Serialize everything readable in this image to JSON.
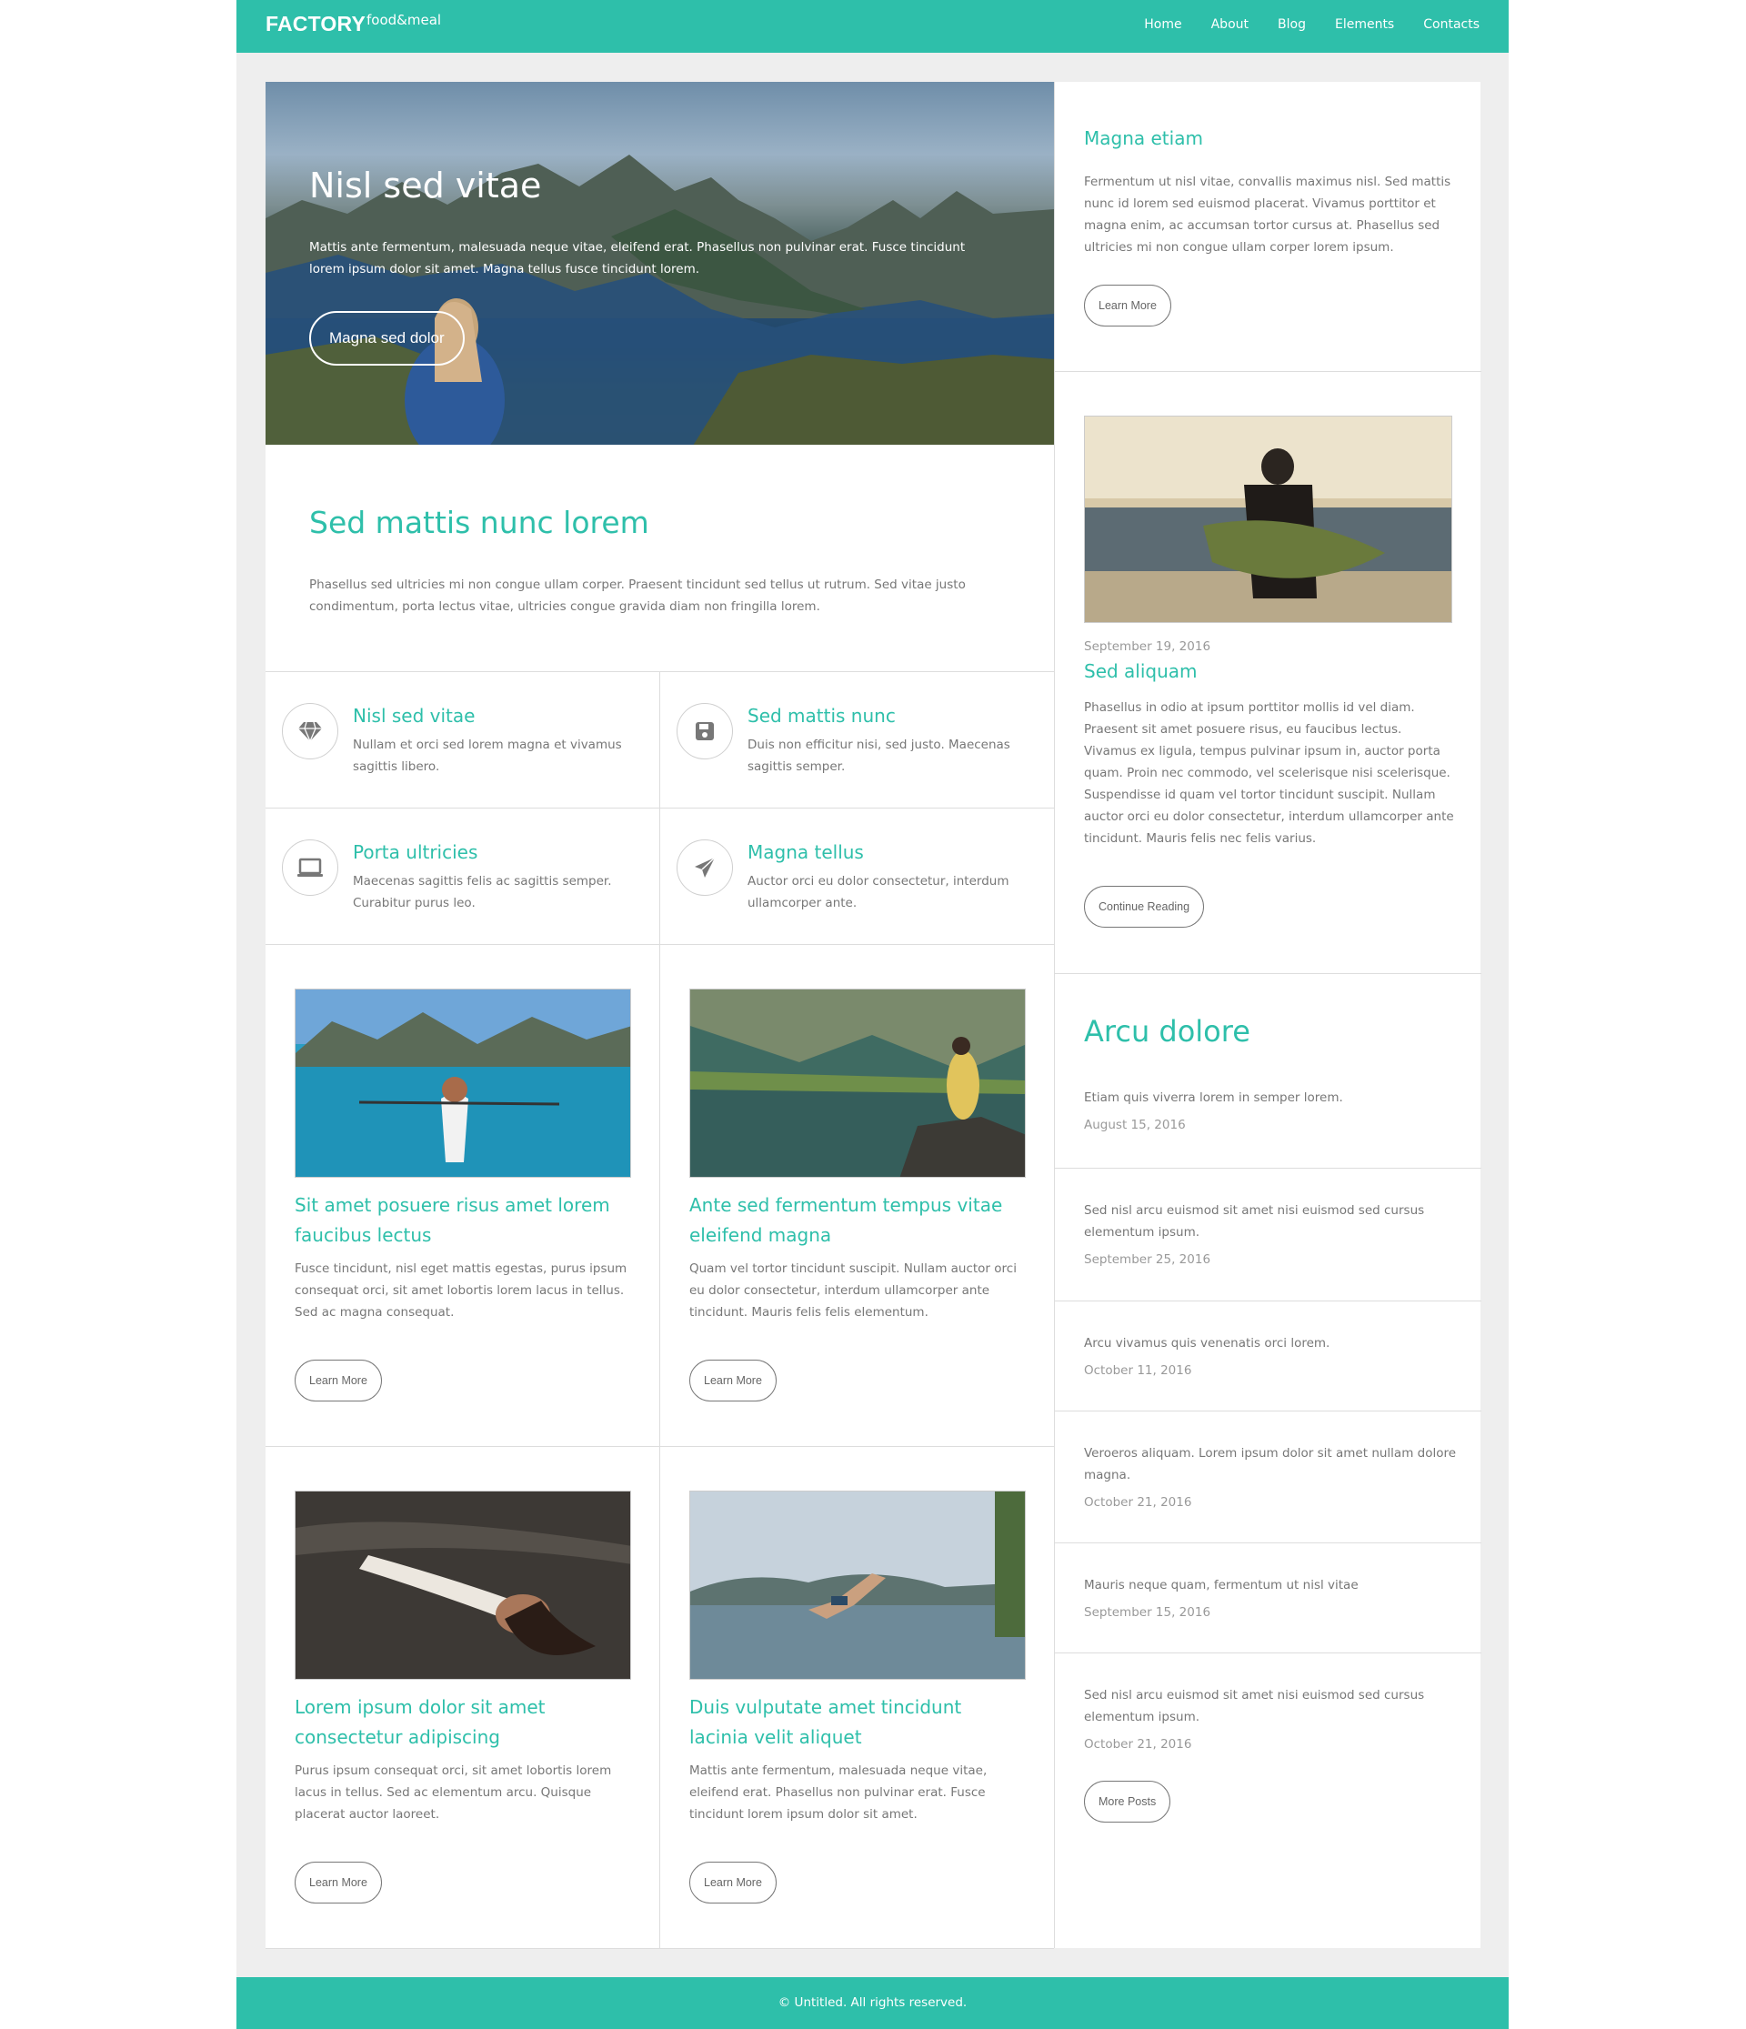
{
  "header": {
    "logo": "FACTORY",
    "logo_sub": "food&meal",
    "nav": [
      "Home",
      "About",
      "Blog",
      "Elements",
      "Contacts"
    ]
  },
  "hero": {
    "title": "Nisl sed vitae",
    "text": "Mattis ante fermentum, malesuada neque vitae, eleifend erat. Phasellus non pulvinar erat. Fusce tincidunt lorem ipsum dolor sit amet. Magna tellus fusce tincidunt lorem.",
    "button": "Magna sed dolor"
  },
  "intro": {
    "title": "Sed mattis nunc lorem",
    "text": "Phasellus sed ultricies mi non congue ullam corper. Praesent tincidunt sed tellus ut rutrum. Sed vitae justo condimentum, porta lectus vitae, ultricies congue gravida diam non fringilla lorem."
  },
  "features": [
    {
      "icon": "diamond-icon",
      "title": "Nisl sed vitae",
      "text": "Nullam et orci sed lorem magna et vivamus sagittis libero."
    },
    {
      "icon": "save-icon",
      "title": "Sed mattis nunc",
      "text": "Duis non efficitur nisi, sed justo. Maecenas sagittis semper."
    },
    {
      "icon": "laptop-icon",
      "title": "Porta ultricies",
      "text": "Maecenas sagittis felis ac sagittis semper. Curabitur purus leo."
    },
    {
      "icon": "paper-plane-icon",
      "title": "Magna tellus",
      "text": "Auctor orci eu dolor consectetur, interdum ullamcorper ante."
    }
  ],
  "posts": [
    {
      "title": "Sit amet posuere risus amet lorem faucibus lectus",
      "text": "Fusce tincidunt, nisl eget mattis egestas, purus ipsum consequat orci, sit amet lobortis lorem lacus in tellus. Sed ac magna consequat.",
      "button": "Learn More"
    },
    {
      "title": "Ante sed fermentum tempus vitae eleifend magna",
      "text": "Quam vel tortor tincidunt suscipit. Nullam auctor orci eu dolor consectetur, interdum ullamcorper ante tincidunt. Mauris felis felis elementum.",
      "button": "Learn More"
    },
    {
      "title": "Lorem ipsum dolor sit amet consectetur adipiscing",
      "text": "Purus ipsum consequat orci, sit amet lobortis lorem lacus in tellus. Sed ac elementum arcu. Quisque placerat auctor laoreet.",
      "button": "Learn More"
    },
    {
      "title": "Duis vulputate amet tincidunt lacinia velit aliquet",
      "text": "Mattis ante fermentum, malesuada neque vitae, eleifend erat. Phasellus non pulvinar erat. Fusce tincidunt lorem ipsum dolor sit amet.",
      "button": "Learn More"
    }
  ],
  "sidebar": {
    "magna": {
      "title": "Magna etiam",
      "text": "Fermentum ut nisl vitae, convallis maximus nisl. Sed mattis nunc id lorem sed euismod placerat. Vivamus porttitor et magna enim, ac accumsan tortor cursus at. Phasellus sed ultricies mi non congue ullam corper lorem ipsum.",
      "button": "Learn More"
    },
    "article": {
      "date": "September 19, 2016",
      "title": "Sed aliquam",
      "text": "Phasellus in odio at ipsum porttitor mollis id vel diam. Praesent sit amet posuere risus, eu faucibus lectus. Vivamus ex ligula, tempus pulvinar ipsum in, auctor porta quam. Proin nec commodo, vel scelerisque nisi scelerisque. Suspendisse id quam vel tortor tincidunt suscipit. Nullam auctor orci eu dolor consectetur, interdum ullamcorper ante tincidunt. Mauris felis nec felis varius.",
      "button": "Continue Reading"
    },
    "arcu": {
      "title": "Arcu dolore",
      "items": [
        {
          "text": "Etiam quis viverra lorem in semper lorem.",
          "date": "August 15, 2016"
        },
        {
          "text": "Sed nisl arcu euismod sit amet nisi euismod sed cursus elementum ipsum.",
          "date": "September 25, 2016"
        },
        {
          "text": "Arcu vivamus quis venenatis orci lorem.",
          "date": "October 11, 2016"
        },
        {
          "text": "Veroeros aliquam. Lorem ipsum dolor sit amet nullam dolore magna.",
          "date": "October 21, 2016"
        },
        {
          "text": "Mauris neque quam, fermentum ut nisl vitae",
          "date": "September 15, 2016"
        },
        {
          "text": "Sed nisl arcu euismod sit amet nisi euismod sed cursus elementum ipsum.",
          "date": "October 21, 2016"
        }
      ],
      "button": "More Posts"
    }
  },
  "footer": {
    "text": "© Untitled. All rights reserved."
  },
  "colors": {
    "accent": "#2ebfaa",
    "page_bg": "#eeeeee",
    "text": "#777777"
  }
}
